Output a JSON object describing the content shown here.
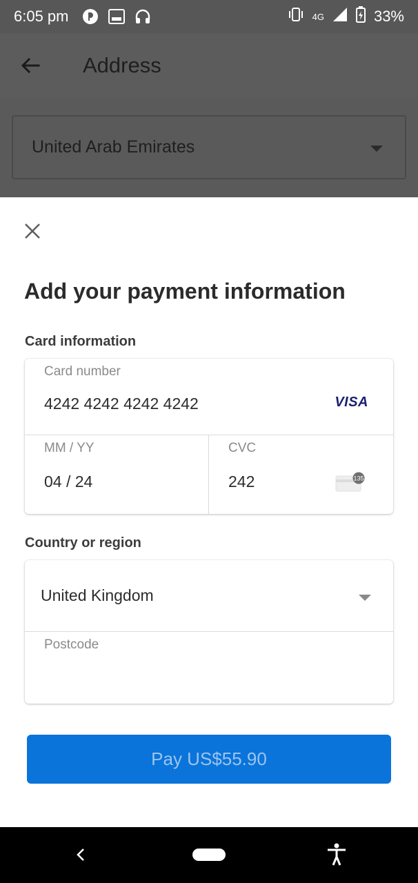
{
  "status_bar": {
    "time": "6:05 pm",
    "network": "4G",
    "battery": "33%",
    "icons": [
      "app-notification-icon",
      "screenshot-icon",
      "headset-icon",
      "vibrate-icon",
      "signal-icon",
      "battery-charging-icon"
    ]
  },
  "app_bar": {
    "title": "Address",
    "back_icon": "back-arrow-icon"
  },
  "background_form": {
    "country_value": "United Arab Emirates"
  },
  "sheet": {
    "close_icon": "close-icon",
    "title": "Add your payment information",
    "card_section_label": "Card information",
    "card_number": {
      "label": "Card number",
      "value": "4242 4242 4242 4242",
      "brand": "VISA"
    },
    "expiry": {
      "placeholder": "MM / YY",
      "value": "04 / 24"
    },
    "cvc": {
      "label": "CVC",
      "value": "242",
      "icon_text": "135"
    },
    "region_section_label": "Country or region",
    "country": {
      "value": "United Kingdom"
    },
    "postcode": {
      "label": "Postcode",
      "value": ""
    },
    "pay_button": "Pay US$55.90"
  },
  "colors": {
    "primary": "#0a74da",
    "pay_text": "#9cc4ee",
    "scrim": "#575757",
    "visa": "#1a1f71"
  }
}
